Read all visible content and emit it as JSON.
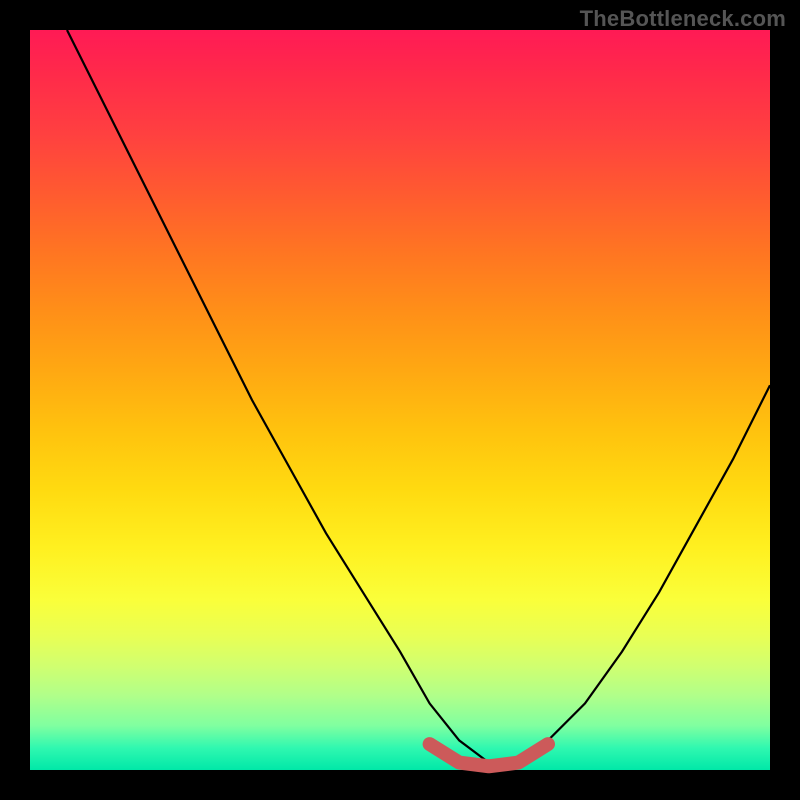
{
  "watermark": "TheBottleneck.com",
  "chart_data": {
    "type": "line",
    "title": "",
    "xlabel": "",
    "ylabel": "",
    "xlim": [
      0,
      100
    ],
    "ylim": [
      0,
      100
    ],
    "series": [
      {
        "name": "curve",
        "x": [
          5,
          10,
          15,
          20,
          25,
          30,
          35,
          40,
          45,
          50,
          54,
          58,
          62,
          66,
          70,
          75,
          80,
          85,
          90,
          95,
          100
        ],
        "y": [
          100,
          90,
          80,
          70,
          60,
          50,
          41,
          32,
          24,
          16,
          9,
          4,
          1,
          1,
          4,
          9,
          16,
          24,
          33,
          42,
          52
        ]
      }
    ],
    "trough": {
      "x": [
        54,
        58,
        62,
        66,
        70
      ],
      "y": [
        3.5,
        1,
        0.5,
        1,
        3.5
      ]
    },
    "colors": {
      "curve": "#000000",
      "trough": "#cc5a5a",
      "gradient_top": "#ff1a55",
      "gradient_bottom": "#00e8a8"
    }
  }
}
